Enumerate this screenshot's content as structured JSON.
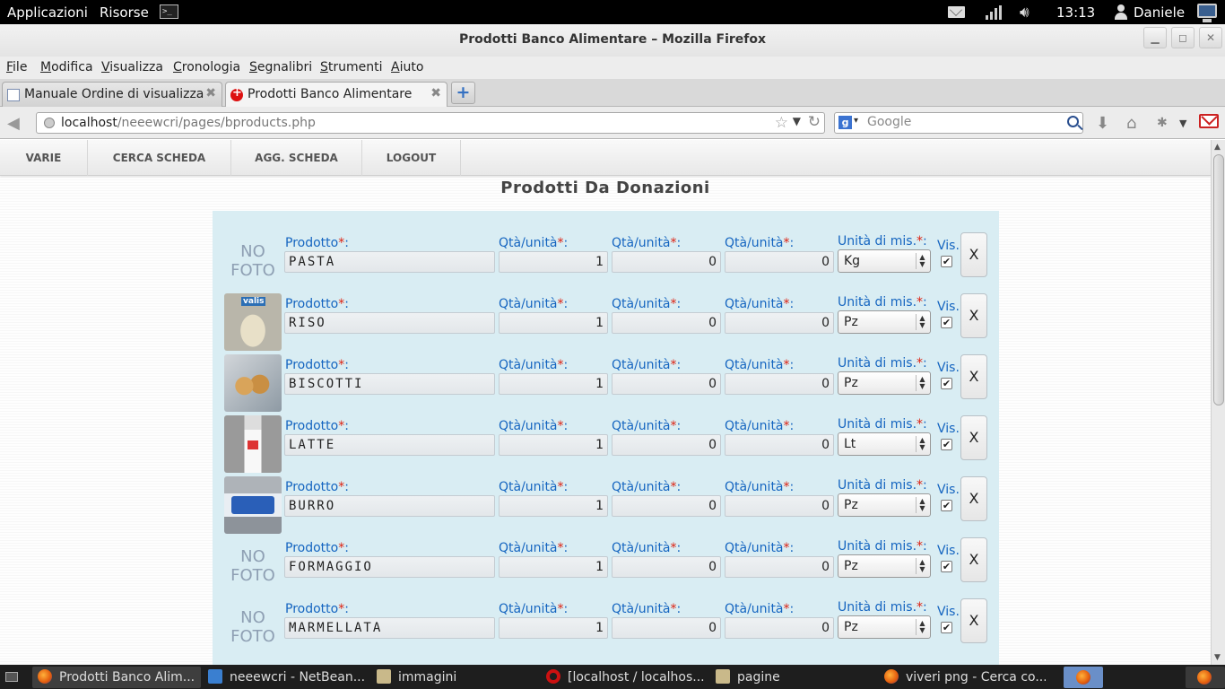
{
  "topbar": {
    "applications": "Applicazioni",
    "resources": "Risorse",
    "clock": "13:13",
    "user": "Daniele"
  },
  "window": {
    "title": "Prodotti Banco Alimentare – Mozilla Firefox"
  },
  "menubar": {
    "items": [
      {
        "label": "File",
        "accel": "F",
        "rest": "ile"
      },
      {
        "label": "Modifica",
        "accel": "M",
        "rest": "odifica"
      },
      {
        "label": "Visualizza",
        "accel": "V",
        "rest": "isualizza"
      },
      {
        "label": "Cronologia",
        "accel": "C",
        "rest": "ronologia"
      },
      {
        "label": "Segnalibri",
        "accel": "S",
        "rest": "egnalibri"
      },
      {
        "label": "Strumenti",
        "accel": "S",
        "rest": "trumenti"
      },
      {
        "label": "Aiuto",
        "accel": "A",
        "rest": "iuto"
      }
    ]
  },
  "tabs": [
    {
      "title": "Manuale Ordine di visualizza...",
      "active": false
    },
    {
      "title": "Prodotti Banco Alimentare",
      "active": true
    }
  ],
  "navbar": {
    "url_host": "localhost",
    "url_path": "/neeewcri/pages/bproducts.php",
    "search_placeholder": "Google"
  },
  "site_nav": [
    "VARIE",
    "CERCA SCHEDA",
    "AGG. SCHEDA",
    "LOGOUT"
  ],
  "page_title": "Prodotti Da Donazioni",
  "labels": {
    "prodotto": "Prodotto",
    "qta": "Qtà/unità",
    "unita": "Unità di mis.",
    "required": "*",
    "colon": ":",
    "vis": "Vis.",
    "delete": "X",
    "no_photo_1": "NO",
    "no_photo_2": "FOTO"
  },
  "products": [
    {
      "name": "PASTA",
      "q1": "1",
      "q2": "0",
      "q3": "0",
      "unit": "Kg",
      "visible": true,
      "photo": "none"
    },
    {
      "name": "RISO",
      "q1": "1",
      "q2": "0",
      "q3": "0",
      "unit": "Pz",
      "visible": true,
      "photo": "riso"
    },
    {
      "name": "BISCOTTI",
      "q1": "1",
      "q2": "0",
      "q3": "0",
      "unit": "Pz",
      "visible": true,
      "photo": "biscotti"
    },
    {
      "name": "LATTE",
      "q1": "1",
      "q2": "0",
      "q3": "0",
      "unit": "Lt",
      "visible": true,
      "photo": "latte"
    },
    {
      "name": "BURRO",
      "q1": "1",
      "q2": "0",
      "q3": "0",
      "unit": "Pz",
      "visible": true,
      "photo": "burro"
    },
    {
      "name": "FORMAGGIO",
      "q1": "1",
      "q2": "0",
      "q3": "0",
      "unit": "Pz",
      "visible": true,
      "photo": "none"
    },
    {
      "name": "MARMELLATA",
      "q1": "1",
      "q2": "0",
      "q3": "0",
      "unit": "Pz",
      "visible": true,
      "photo": "none"
    }
  ],
  "taskbar": [
    {
      "label": "Prodotti Banco Alim...",
      "icon": "firefox-icon",
      "active": true
    },
    {
      "label": "neeewcri - NetBean...",
      "icon": "netbeans-icon",
      "active": false
    },
    {
      "label": "immagini",
      "icon": "folder-icon",
      "active": false
    },
    {
      "label": "[localhost / localhos...",
      "icon": "opera-icon",
      "active": false
    },
    {
      "label": "pagine",
      "icon": "folder-icon",
      "active": false
    },
    {
      "label": "viveri png - Cerca co...",
      "icon": "firefox-icon",
      "active": false
    }
  ],
  "colors": {
    "panel": "#d9edf3",
    "label_blue": "#1565c0",
    "required_red": "#d21"
  }
}
